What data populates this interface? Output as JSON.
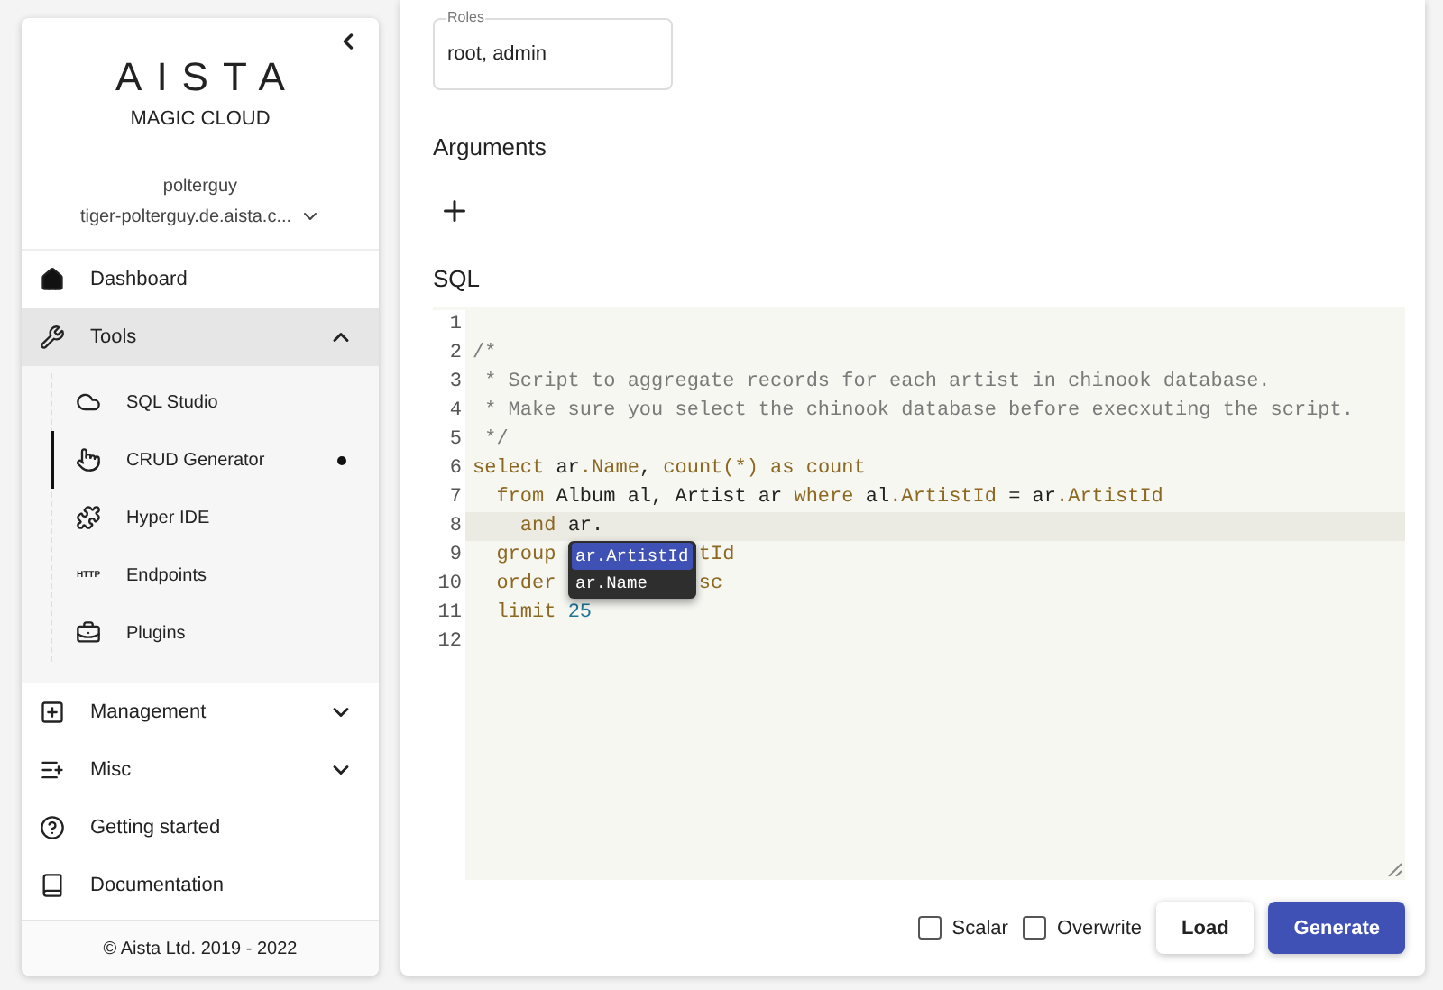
{
  "sidebar": {
    "logo": "AISTA",
    "subtitle": "MAGIC CLOUD",
    "user": "polterguy",
    "server": "tiger-polterguy.de.aista.c...",
    "nav": [
      {
        "label": "Dashboard"
      },
      {
        "label": "Tools",
        "expanded": true,
        "children": [
          {
            "label": "SQL Studio",
            "selected": false
          },
          {
            "label": "CRUD Generator",
            "selected": true
          },
          {
            "label": "Hyper IDE",
            "selected": false
          },
          {
            "label": "Endpoints",
            "selected": false,
            "icon_text": "HTTP"
          },
          {
            "label": "Plugins",
            "selected": false
          }
        ]
      },
      {
        "label": "Management",
        "expanded": false
      },
      {
        "label": "Misc",
        "expanded": false
      },
      {
        "label": "Getting started"
      },
      {
        "label": "Documentation"
      }
    ],
    "footer": "© Aista Ltd. 2019 - 2022"
  },
  "main": {
    "roles": {
      "label": "Roles",
      "value": "root, admin"
    },
    "arguments_heading": "Arguments",
    "sql_heading": "SQL",
    "editor": {
      "lines": [
        {
          "number": "1",
          "active": false
        },
        {
          "number": "2",
          "active": false,
          "segments": [
            [
              {
                "text": "/*",
                "kind": "comment"
              }
            ]
          ]
        },
        {
          "number": "3",
          "active": false,
          "segments": [
            [
              {
                "text": " * Script to aggregate records for each artist in chinook database.",
                "kind": "comment"
              }
            ]
          ]
        },
        {
          "number": "4",
          "active": false,
          "segments": [
            [
              {
                "text": " * Make sure you select the chinook database before execxuting the script.",
                "kind": "comment"
              }
            ]
          ]
        },
        {
          "number": "5",
          "active": false,
          "segments": [
            [
              {
                "text": " */",
                "kind": "comment"
              }
            ]
          ]
        },
        {
          "number": "6",
          "active": false,
          "segments": [
            [
              {
                "text": "select",
                "kind": "kw"
              },
              {
                "text": " ar",
                "kind": "plain"
              },
              {
                "text": ".Name",
                "kind": "prop"
              },
              {
                "text": ", ",
                "kind": "plain"
              },
              {
                "text": "count(*)",
                "kind": "kw"
              },
              {
                "text": " as ",
                "kind": "kw"
              },
              {
                "text": "count",
                "kind": "kw"
              }
            ]
          ]
        },
        {
          "number": "7",
          "active": false,
          "segments": [
            [
              {
                "text": "  from",
                "kind": "kw"
              },
              {
                "text": " Album al, Artist ar ",
                "kind": "plain"
              },
              {
                "text": "where",
                "kind": "kw"
              },
              {
                "text": " al",
                "kind": "plain"
              },
              {
                "text": ".ArtistId",
                "kind": "prop"
              },
              {
                "text": " = ar",
                "kind": "plain"
              },
              {
                "text": ".ArtistId",
                "kind": "prop"
              }
            ]
          ]
        },
        {
          "number": "8",
          "active": true,
          "segments": [
            [
              {
                "text": "    and",
                "kind": "kw"
              },
              {
                "text": " ar.",
                "kind": "plain"
              }
            ]
          ]
        },
        {
          "number": "9",
          "active": false,
          "segments": [
            [
              {
                "text": "  group",
                "kind": "kw"
              }
            ],
            [
              {
                "text": "tId",
                "kind": "prop"
              }
            ]
          ]
        },
        {
          "number": "10",
          "active": false,
          "segments": [
            [
              {
                "text": "  order",
                "kind": "kw"
              }
            ],
            [
              {
                "text": "sc",
                "kind": "kw"
              }
            ]
          ]
        },
        {
          "number": "11",
          "active": false,
          "segments": [
            [
              {
                "text": "  limit",
                "kind": "kw"
              },
              {
                "text": " 25",
                "kind": "num"
              }
            ]
          ]
        },
        {
          "number": "12",
          "active": false
        }
      ],
      "suggestions": [
        {
          "label": "ar.ArtistId",
          "selected": true
        },
        {
          "label": "ar.Name",
          "selected": false
        }
      ]
    },
    "options": [
      {
        "label": "Scalar",
        "checked": false
      },
      {
        "label": "Overwrite",
        "checked": false
      }
    ],
    "buttons": [
      {
        "label": "Load",
        "kind": "secondary"
      },
      {
        "label": "Generate",
        "kind": "primary"
      }
    ]
  }
}
